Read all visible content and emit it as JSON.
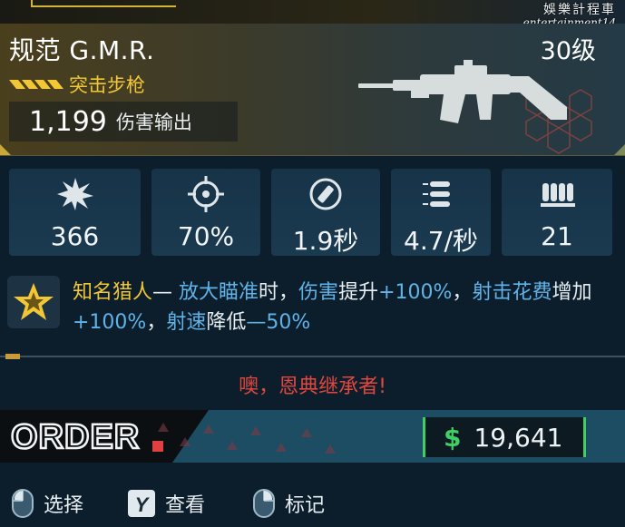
{
  "watermark": {
    "line1": "娛樂計程車",
    "line2": "entertainment14"
  },
  "weapon": {
    "name": "规范 G.M.R.",
    "level": "30级",
    "type": "突击步枪",
    "damage_value": "1,199",
    "damage_label": "伤害输出",
    "rarity_color": "#f2c735"
  },
  "stats": [
    {
      "icon": "impact-icon",
      "value": "366"
    },
    {
      "icon": "crosshair-icon",
      "value": "70%"
    },
    {
      "icon": "reload-icon",
      "value": "1.9秒"
    },
    {
      "icon": "bullets-icon",
      "value": "4.7/秒"
    },
    {
      "icon": "magazine-icon",
      "value": "21"
    }
  ],
  "perk": {
    "icon": "perk-star-icon",
    "name": "知名猎人",
    "dash": "— ",
    "p1": "放大瞄准",
    "p2": "时，",
    "p3": "伤害",
    "p4": "提升",
    "p5": "+100%",
    "p6": "，",
    "p7": "射击花费",
    "p8": "增加",
    "p9": "+100%",
    "p10": "，",
    "p11": "射速",
    "p12": "降低",
    "p13": "—50%"
  },
  "tagline": "噢，恩典继承者!",
  "tagline_color": "#e0473f",
  "order": {
    "logo_text": "ORDER"
  },
  "price": {
    "currency_symbol": "$",
    "amount": "19,641",
    "accent": "#3fcf66"
  },
  "controls": [
    {
      "key_icon": "mouse-button-icon",
      "label": "选择"
    },
    {
      "key_icon": "y-key-icon",
      "key_text": "Y",
      "label": "查看"
    },
    {
      "key_icon": "mouse-button-icon",
      "label": "标记"
    }
  ]
}
